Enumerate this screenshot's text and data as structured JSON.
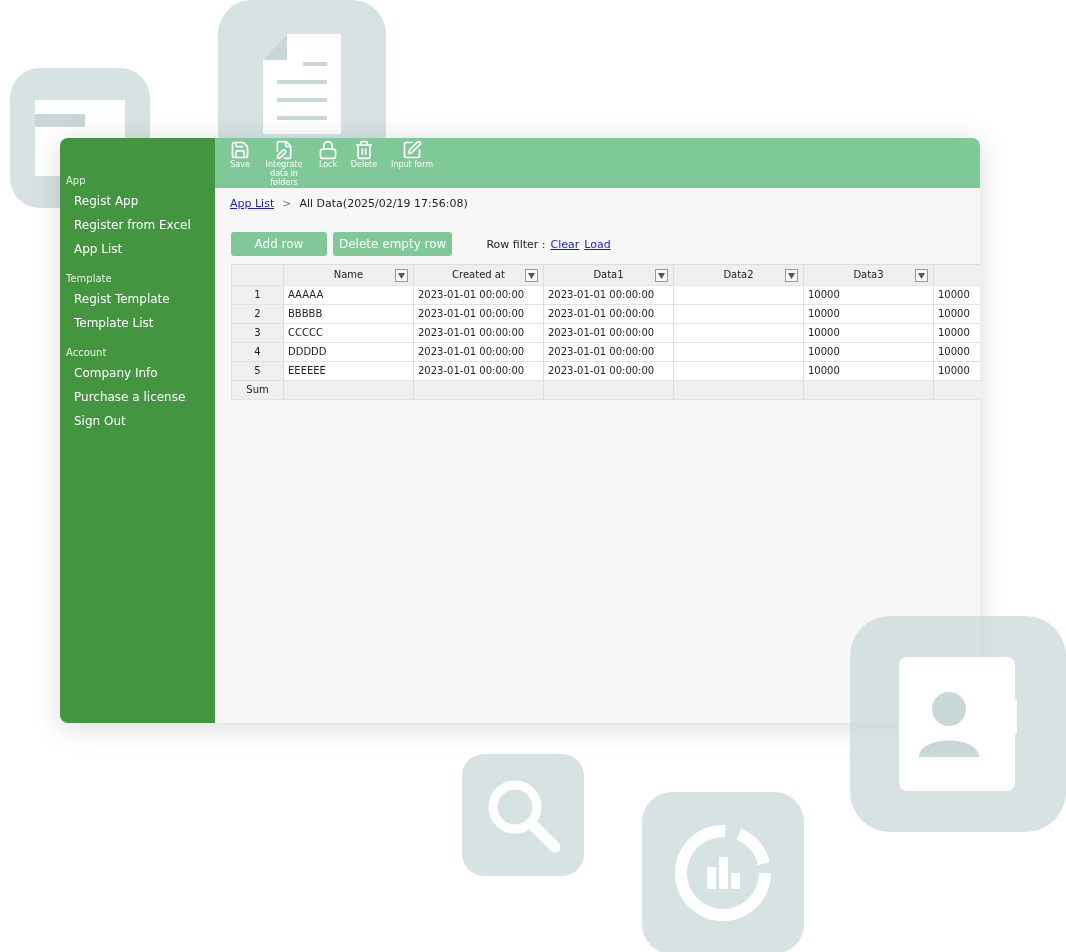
{
  "sidebar": {
    "sections": [
      {
        "heading": "App",
        "items": [
          {
            "label": "Regist App"
          },
          {
            "label": "Register from Excel"
          },
          {
            "label": "App List"
          }
        ]
      },
      {
        "heading": "Template",
        "items": [
          {
            "label": "Regist Template"
          },
          {
            "label": "Template List"
          }
        ]
      },
      {
        "heading": "Account",
        "items": [
          {
            "label": "Company Info"
          },
          {
            "label": "Purchase a license"
          },
          {
            "label": "Sign Out"
          }
        ]
      }
    ]
  },
  "toolbar": [
    {
      "kind": "save",
      "label": "Save"
    },
    {
      "kind": "integrate",
      "label": "Integrate data in folders"
    },
    {
      "kind": "lock",
      "label": "Lock"
    },
    {
      "kind": "delete",
      "label": "Delete"
    },
    {
      "kind": "form",
      "label": "Input form"
    }
  ],
  "breadcrumb": {
    "link": "App List",
    "separator": ">",
    "current": "All Data(2025/02/19 17:56:08)"
  },
  "actions": [
    "Add row",
    "Delete empty row"
  ],
  "row_filter": {
    "label": "Row filter :",
    "links": [
      "Clear",
      "Load"
    ]
  },
  "table": {
    "columns": [
      {
        "label": "Name",
        "filter": true
      },
      {
        "label": "Created at",
        "filter": true
      },
      {
        "label": "Data1",
        "filter": true
      },
      {
        "label": "Data2",
        "filter": true
      },
      {
        "label": "Data3",
        "filter": true
      },
      {
        "filter": false
      }
    ],
    "rows": [
      {
        "number": "1",
        "cells": [
          "AAAAA",
          "2023-01-01 00:00:00",
          "2023-01-01 00:00:00",
          null,
          "10000",
          "10000"
        ]
      },
      {
        "number": "2",
        "cells": [
          "BBBBB",
          "2023-01-01 00:00:00",
          "2023-01-01 00:00:00",
          null,
          "10000",
          "10000"
        ]
      },
      {
        "number": "3",
        "cells": [
          "CCCCC",
          "2023-01-01 00:00:00",
          "2023-01-01 00:00:00",
          null,
          "10000",
          "10000"
        ]
      },
      {
        "number": "4",
        "cells": [
          "DDDDD",
          "2023-01-01 00:00:00",
          "2023-01-01 00:00:00",
          null,
          "10000",
          "10000"
        ]
      },
      {
        "number": "5",
        "cells": [
          "EEEEEE",
          "2023-01-01 00:00:00",
          "2023-01-01 00:00:00",
          null,
          "10000",
          "10000"
        ]
      }
    ],
    "sum_label": "Sum"
  }
}
